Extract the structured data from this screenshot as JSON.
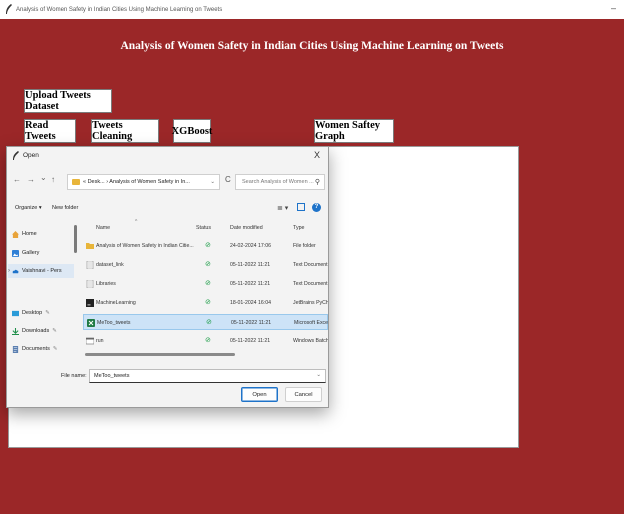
{
  "window": {
    "title": "Analysis of Women Safety in Indian Cities Using Machine Learning on Tweets",
    "minimize": "–"
  },
  "app": {
    "heading": "Analysis of Women Safety in Indian Cities Using Machine Learning on Tweets",
    "buttons": {
      "upload": "Upload Tweets Dataset",
      "read": "Read Tweets",
      "cleaning": "Tweets Cleaning",
      "xgboost": "XGBoost",
      "graph": "Women Saftey Graph"
    },
    "colors": {
      "background": "#9b2728"
    }
  },
  "dialog": {
    "title": "Open",
    "close": "X",
    "nav": {
      "back": "←",
      "forward": "→",
      "down": "⌄",
      "up": "↑"
    },
    "address": "« Desk... › Analysis of Women Safety in In...",
    "address_chevron": "⌄",
    "refresh": "C",
    "search_placeholder": "Search Analysis of Women ...",
    "search_icon": "⚲",
    "toolbar": {
      "organize": "Organize ▾",
      "new_folder": "New folder",
      "view_icon": "≣ ▾",
      "help": "?"
    },
    "sidebar": [
      {
        "label": "Home",
        "icon": "home-icon",
        "pin": ""
      },
      {
        "label": "Gallery",
        "icon": "gallery-icon",
        "pin": ""
      },
      {
        "label": "Vaishnavi - Pers",
        "icon": "cloud-icon",
        "pin": ""
      },
      {
        "label": "Desktop",
        "icon": "desktop-icon",
        "pin": "✎"
      },
      {
        "label": "Downloads",
        "icon": "download-icon",
        "pin": "✎"
      },
      {
        "label": "Documents",
        "icon": "documents-icon",
        "pin": "✎"
      }
    ],
    "sidebar_expander": "›",
    "columns": {
      "name": "Name",
      "status": "Status",
      "date": "Date modified",
      "type": "Type"
    },
    "files": [
      {
        "name": "Analysis of Women Safety in Indian Citie...",
        "status": "⊘",
        "date": "24-02-2024 17:06",
        "type": "File folder",
        "icon": "folder-icon"
      },
      {
        "name": "dataset_link",
        "status": "⊘",
        "date": "05-11-2022 11:21",
        "type": "Text Document",
        "icon": "text-file-icon"
      },
      {
        "name": "Libraries",
        "status": "⊘",
        "date": "05-11-2022 11:21",
        "type": "Text Document",
        "icon": "text-file-icon"
      },
      {
        "name": "MachineLearning",
        "status": "⊘",
        "date": "18-01-2024 16:04",
        "type": "JetBrains PyChar...",
        "icon": "pycharm-icon"
      },
      {
        "name": "MeToo_tweets",
        "status": "⊘",
        "date": "05-11-2022 11:21",
        "type": "Microsoft Excel C",
        "icon": "excel-icon",
        "selected": true
      },
      {
        "name": "run",
        "status": "⊘",
        "date": "05-11-2022 11:21",
        "type": "Windows Batch F",
        "icon": "batch-file-icon"
      }
    ],
    "file_name_label": "File name:",
    "file_name_value": "MeToo_tweets",
    "file_name_chevron": "⌄",
    "open_label": "Open",
    "cancel_label": "Cancel"
  }
}
